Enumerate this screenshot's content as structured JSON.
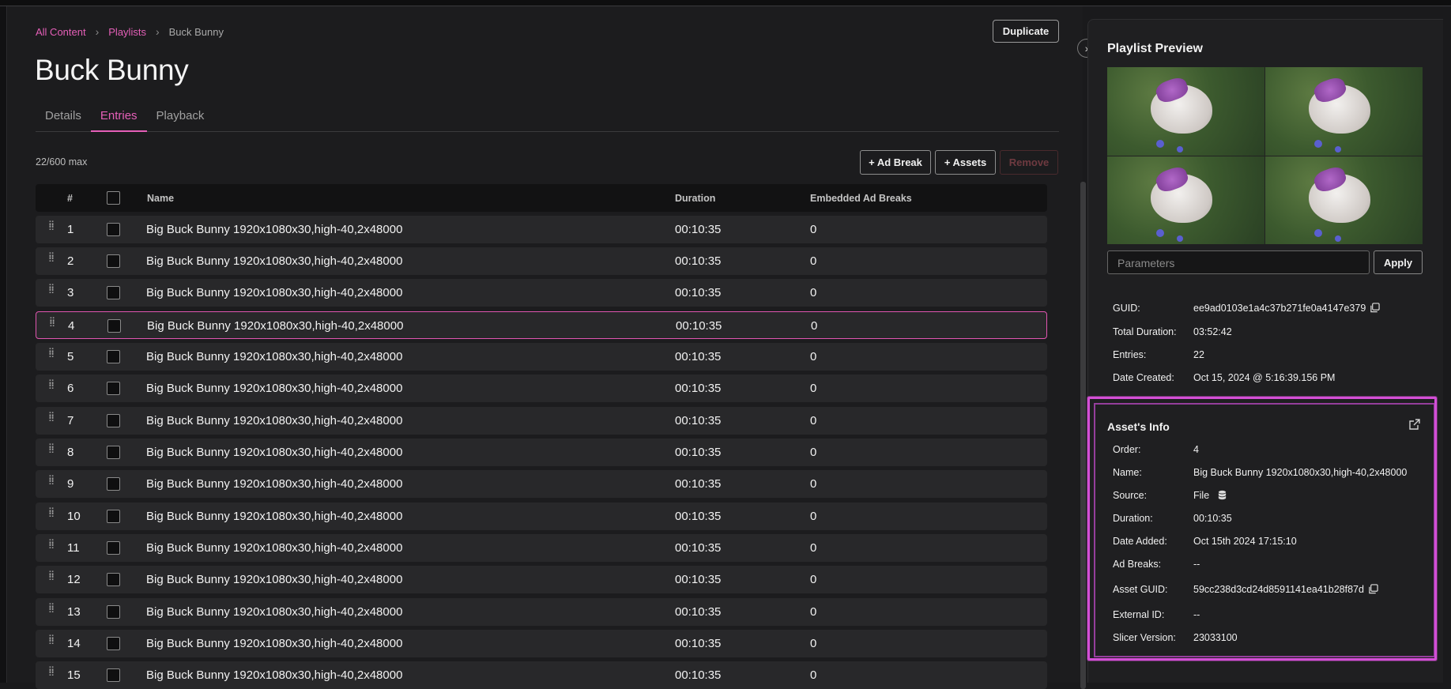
{
  "breadcrumb": {
    "all_content": "All Content",
    "playlists": "Playlists",
    "current": "Buck Bunny"
  },
  "page_title": "Buck Bunny",
  "duplicate_label": "Duplicate",
  "tabs": [
    {
      "label": "Details"
    },
    {
      "label": "Entries",
      "active": true
    },
    {
      "label": "Playback"
    }
  ],
  "entries_count": "22/600 max",
  "actions": {
    "ad_break": "+ Ad Break",
    "assets": "+ Assets",
    "remove": "Remove"
  },
  "table": {
    "headers": {
      "num": "#",
      "name": "Name",
      "duration": "Duration",
      "ad_breaks": "Embedded Ad Breaks"
    },
    "selected_row": 4,
    "rows": [
      {
        "num": "1",
        "name": "Big Buck Bunny 1920x1080x30,high-40,2x48000",
        "duration": "00:10:35",
        "ad_breaks": "0"
      },
      {
        "num": "2",
        "name": "Big Buck Bunny 1920x1080x30,high-40,2x48000",
        "duration": "00:10:35",
        "ad_breaks": "0"
      },
      {
        "num": "3",
        "name": "Big Buck Bunny 1920x1080x30,high-40,2x48000",
        "duration": "00:10:35",
        "ad_breaks": "0"
      },
      {
        "num": "4",
        "name": "Big Buck Bunny 1920x1080x30,high-40,2x48000",
        "duration": "00:10:35",
        "ad_breaks": "0"
      },
      {
        "num": "5",
        "name": "Big Buck Bunny 1920x1080x30,high-40,2x48000",
        "duration": "00:10:35",
        "ad_breaks": "0"
      },
      {
        "num": "6",
        "name": "Big Buck Bunny 1920x1080x30,high-40,2x48000",
        "duration": "00:10:35",
        "ad_breaks": "0"
      },
      {
        "num": "7",
        "name": "Big Buck Bunny 1920x1080x30,high-40,2x48000",
        "duration": "00:10:35",
        "ad_breaks": "0"
      },
      {
        "num": "8",
        "name": "Big Buck Bunny 1920x1080x30,high-40,2x48000",
        "duration": "00:10:35",
        "ad_breaks": "0"
      },
      {
        "num": "9",
        "name": "Big Buck Bunny 1920x1080x30,high-40,2x48000",
        "duration": "00:10:35",
        "ad_breaks": "0"
      },
      {
        "num": "10",
        "name": "Big Buck Bunny 1920x1080x30,high-40,2x48000",
        "duration": "00:10:35",
        "ad_breaks": "0"
      },
      {
        "num": "11",
        "name": "Big Buck Bunny 1920x1080x30,high-40,2x48000",
        "duration": "00:10:35",
        "ad_breaks": "0"
      },
      {
        "num": "12",
        "name": "Big Buck Bunny 1920x1080x30,high-40,2x48000",
        "duration": "00:10:35",
        "ad_breaks": "0"
      },
      {
        "num": "13",
        "name": "Big Buck Bunny 1920x1080x30,high-40,2x48000",
        "duration": "00:10:35",
        "ad_breaks": "0"
      },
      {
        "num": "14",
        "name": "Big Buck Bunny 1920x1080x30,high-40,2x48000",
        "duration": "00:10:35",
        "ad_breaks": "0"
      },
      {
        "num": "15",
        "name": "Big Buck Bunny 1920x1080x30,high-40,2x48000",
        "duration": "00:10:35",
        "ad_breaks": "0"
      }
    ]
  },
  "preview": {
    "title": "Playlist Preview",
    "parameters_placeholder": "Parameters",
    "apply_label": "Apply",
    "info": [
      {
        "key": "GUID:",
        "value": "ee9ad0103e1a4c37b271fe0a4147e379",
        "copy": true
      },
      {
        "key": "Total Duration:",
        "value": "03:52:42"
      },
      {
        "key": "Entries:",
        "value": "22"
      },
      {
        "key": "Date Created:",
        "value": "Oct 15, 2024 @ 5:16:39.156 PM"
      }
    ]
  },
  "asset_info": {
    "title": "Asset's Info",
    "fields": [
      {
        "key": "Order:",
        "value": "4"
      },
      {
        "key": "Name:",
        "value": "Big Buck Bunny 1920x1080x30,high-40,2x48000"
      },
      {
        "key": "Source:",
        "value": "File",
        "icon": "database-icon"
      },
      {
        "key": "Duration:",
        "value": "00:10:35"
      },
      {
        "key": "Date Added:",
        "value": "Oct 15th 2024 17:15:10"
      },
      {
        "key": "Ad Breaks:",
        "value": "--"
      },
      {
        "key": "Asset GUID:",
        "value": "59cc238d3cd24d8591141ea41b28f87d",
        "copy": true
      },
      {
        "key": "External ID:",
        "value": "--"
      },
      {
        "key": "Slicer Version:",
        "value": "23033100"
      }
    ]
  },
  "colors": {
    "accent": "#e55fb8",
    "highlight_box": "#d44fd6",
    "background": "#1c1c1e",
    "row": "#28282a"
  }
}
